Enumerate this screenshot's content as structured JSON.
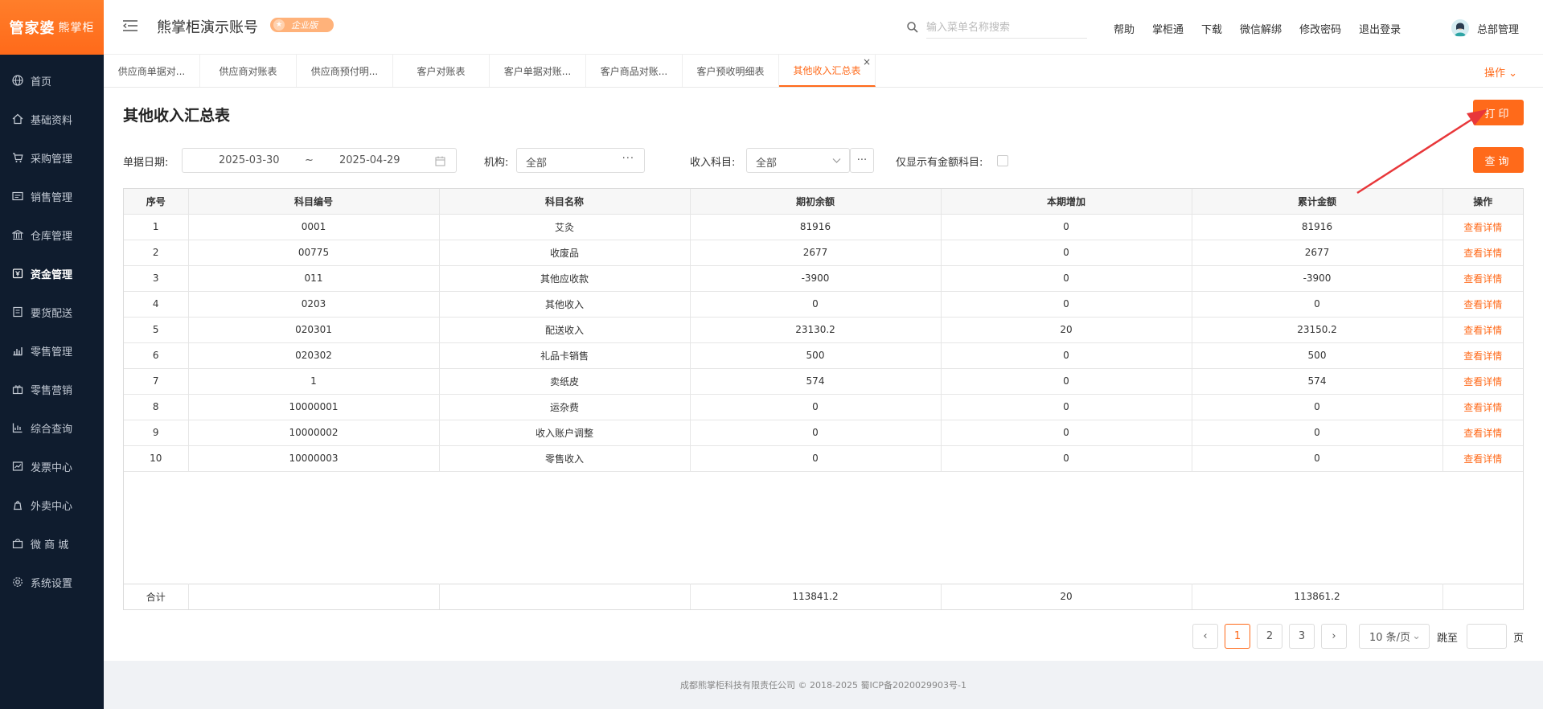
{
  "brand": {
    "logo_main": "管家婆",
    "logo_sub": "熊掌柜"
  },
  "sidebar": {
    "items": [
      {
        "label": "首页",
        "icon": "globe-icon"
      },
      {
        "label": "基础资料",
        "icon": "home-icon"
      },
      {
        "label": "采购管理",
        "icon": "cart-icon"
      },
      {
        "label": "销售管理",
        "icon": "sales-icon"
      },
      {
        "label": "仓库管理",
        "icon": "warehouse-icon"
      },
      {
        "label": "资金管理",
        "icon": "money-icon"
      },
      {
        "label": "要货配送",
        "icon": "delivery-icon"
      },
      {
        "label": "零售管理",
        "icon": "retail-icon"
      },
      {
        "label": "零售营销",
        "icon": "gift-icon"
      },
      {
        "label": "综合查询",
        "icon": "chart-icon"
      },
      {
        "label": "发票中心",
        "icon": "invoice-icon"
      },
      {
        "label": "外卖中心",
        "icon": "takeout-icon"
      },
      {
        "label": "微 商 城",
        "icon": "shop-icon"
      },
      {
        "label": "系统设置",
        "icon": "settings-icon"
      }
    ]
  },
  "header": {
    "account_name": "熊掌柜演示账号",
    "edition_badge": "企业版",
    "search_placeholder": "输入菜单名称搜索",
    "links": [
      "帮助",
      "掌柜通",
      "下载",
      "微信解绑",
      "修改密码",
      "退出登录"
    ],
    "user_name": "总部管理"
  },
  "tabs": [
    {
      "label": "供应商单据对..."
    },
    {
      "label": "供应商对账表"
    },
    {
      "label": "供应商预付明..."
    },
    {
      "label": "客户对账表"
    },
    {
      "label": "客户单据对账..."
    },
    {
      "label": "客户商品对账..."
    },
    {
      "label": "客户预收明细表"
    },
    {
      "label": "其他收入汇总表",
      "active": true
    }
  ],
  "ops_label": "操作",
  "page": {
    "title": "其他收入汇总表",
    "print_label": "打印",
    "query_label": "查询"
  },
  "filters": {
    "date_label": "单据日期:",
    "date_start": "2025-03-30",
    "date_sep": "~",
    "date_end": "2025-04-29",
    "org_label": "机构:",
    "org_value": "全部",
    "subject_label": "收入科目:",
    "subject_value": "全部",
    "only_amount_label": "仅显示有金额科目:"
  },
  "table": {
    "headers": [
      "序号",
      "科目编号",
      "科目名称",
      "期初余额",
      "本期增加",
      "累计金额",
      "操作"
    ],
    "rows": [
      [
        "1",
        "0001",
        "艾灸",
        "81916",
        "0",
        "81916",
        "查看详情"
      ],
      [
        "2",
        "00775",
        "收废品",
        "2677",
        "0",
        "2677",
        "查看详情"
      ],
      [
        "3",
        "011",
        "其他应收款",
        "-3900",
        "0",
        "-3900",
        "查看详情"
      ],
      [
        "4",
        "0203",
        "其他收入",
        "0",
        "0",
        "0",
        "查看详情"
      ],
      [
        "5",
        "020301",
        "配送收入",
        "23130.2",
        "20",
        "23150.2",
        "查看详情"
      ],
      [
        "6",
        "020302",
        "礼品卡销售",
        "500",
        "0",
        "500",
        "查看详情"
      ],
      [
        "7",
        "1",
        "卖纸皮",
        "574",
        "0",
        "574",
        "查看详情"
      ],
      [
        "8",
        "10000001",
        "运杂费",
        "0",
        "0",
        "0",
        "查看详情"
      ],
      [
        "9",
        "10000002",
        "收入账户调整",
        "0",
        "0",
        "0",
        "查看详情"
      ],
      [
        "10",
        "10000003",
        "零售收入",
        "0",
        "0",
        "0",
        "查看详情"
      ]
    ],
    "total": {
      "label": "合计",
      "opening": "113841.2",
      "increase": "20",
      "cumulative": "113861.2"
    }
  },
  "pagination": {
    "pages": [
      "1",
      "2",
      "3"
    ],
    "current": "1",
    "page_size": "10 条/页",
    "jump_label": "跳至",
    "page_unit": "页"
  },
  "footer": {
    "text": "成都熊掌柜科技有限责任公司 © 2018-2025 蜀ICP备2020029903号-1"
  },
  "colors": {
    "accent": "#ff6a1a",
    "sidebar_bg": "#0f1c2e",
    "annotation_arrow": "#e8373a"
  }
}
